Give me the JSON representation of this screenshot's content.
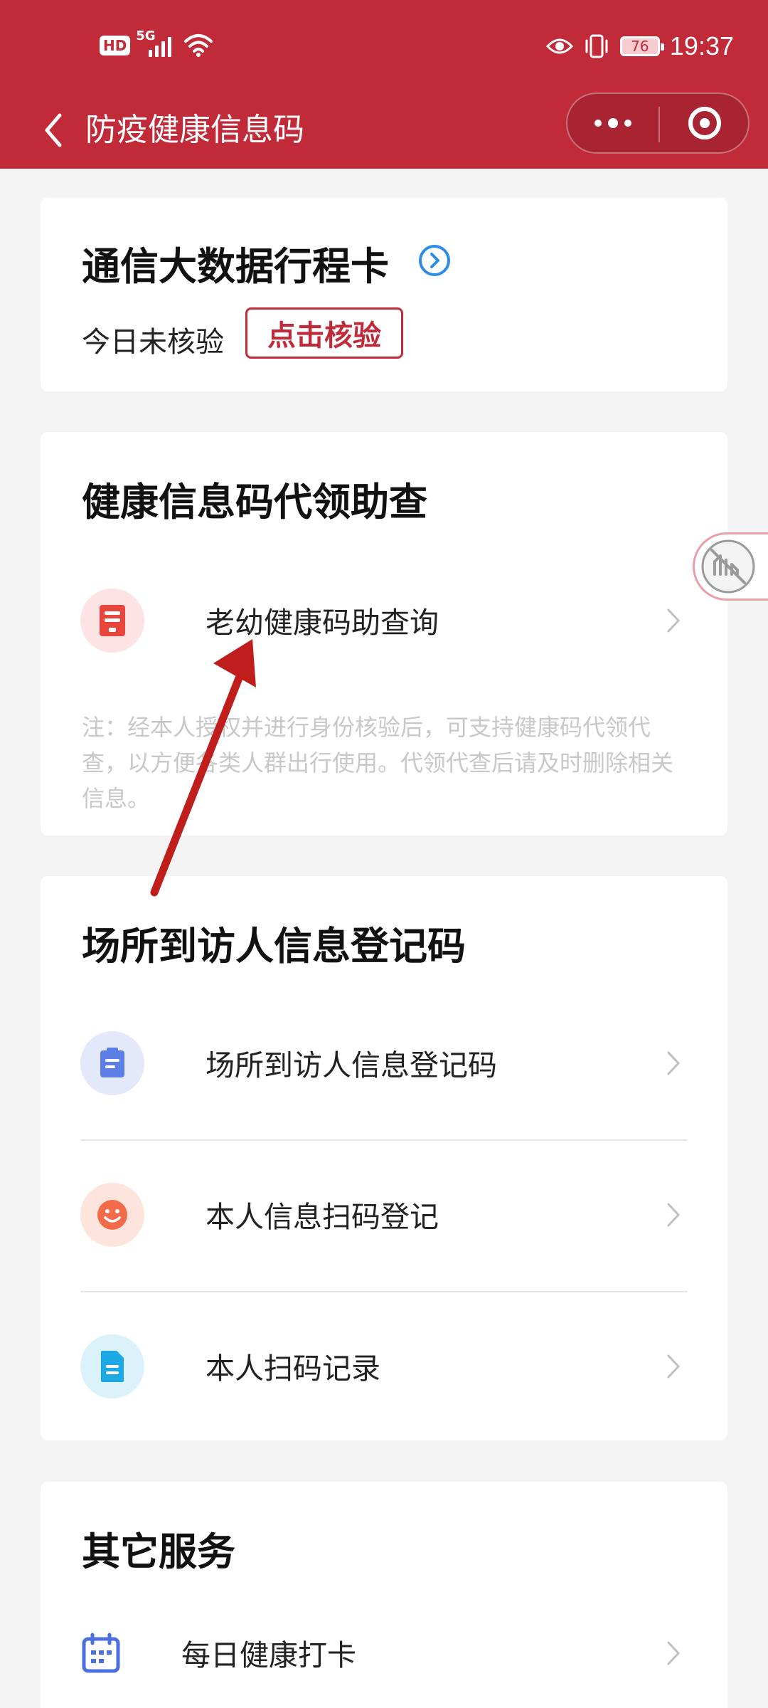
{
  "status_bar": {
    "hd": "HD",
    "network": "5G",
    "battery": "76",
    "time": "19:37",
    "icons": [
      "signal-icon",
      "wifi-icon",
      "eye-icon",
      "vibrate-icon",
      "battery-icon"
    ]
  },
  "nav": {
    "title": "防疫健康信息码",
    "icons": [
      "back-arrow-icon",
      "more-dots-icon",
      "target-close-icon"
    ]
  },
  "card_travel": {
    "title": "通信大数据行程卡",
    "status": "今日未核验",
    "verify_button": "点击核验",
    "icon": "chevron-circle-icon"
  },
  "card_proxy": {
    "title": "健康信息码代领助查",
    "item": {
      "label": "老幼健康码助查询",
      "icon": "document-icon"
    },
    "note": "注：经本人授权并进行身份核验后，可支持健康码代领代查，以方便各类人群出行使用。代领代查后请及时删除相关信息。"
  },
  "card_venue": {
    "title": "场所到访人信息登记码",
    "items": [
      {
        "label": "场所到访人信息登记码",
        "icon": "clipboard-icon"
      },
      {
        "label": "本人信息扫码登记",
        "icon": "smiley-icon"
      },
      {
        "label": "本人扫码记录",
        "icon": "file-icon"
      }
    ]
  },
  "card_other": {
    "title": "其它服务",
    "items": [
      {
        "label": "每日健康打卡",
        "icon": "calendar-icon"
      }
    ]
  },
  "colors": {
    "brand_red": "#c02a39",
    "page_bg": "#f4f4f4",
    "link_blue": "#2c8ce8"
  }
}
